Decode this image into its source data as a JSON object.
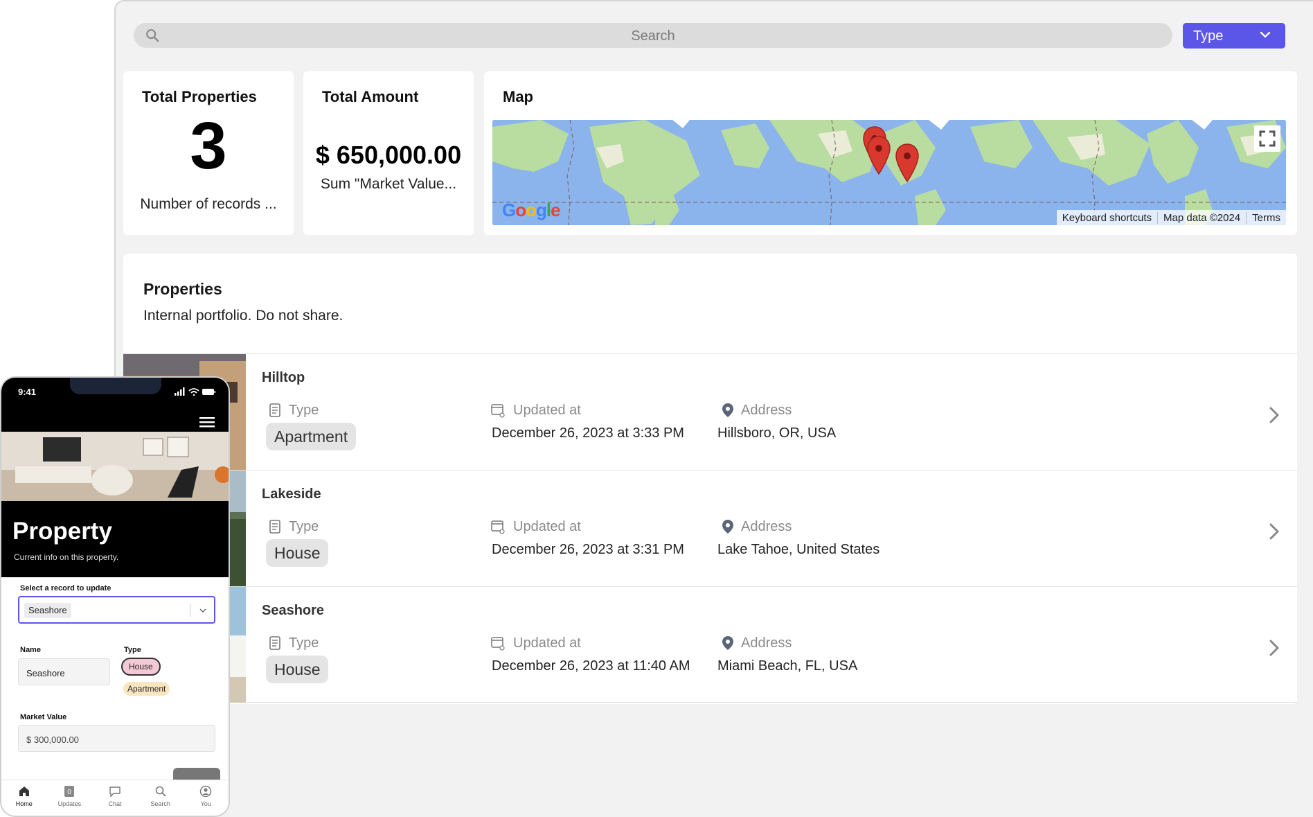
{
  "search": {
    "placeholder": "Search"
  },
  "type_filter": {
    "label": "Type"
  },
  "cards": {
    "total_properties": {
      "title": "Total Properties",
      "value": "3",
      "subtitle": "Number of records ..."
    },
    "total_amount": {
      "title": "Total Amount",
      "value": "$ 650,000.00",
      "subtitle": "Sum \"Market Value..."
    },
    "map": {
      "title": "Map",
      "logo": "Google",
      "attribution": [
        "Keyboard shortcuts",
        "Map data ©2024",
        "Terms"
      ]
    }
  },
  "properties": {
    "title": "Properties",
    "description": "Internal portfolio. Do not share.",
    "field_labels": {
      "type": "Type",
      "updated": "Updated at",
      "address": "Address"
    },
    "rows": [
      {
        "name": "Hilltop",
        "type": "Apartment",
        "updated": "December 26, 2023 at 3:33 PM",
        "address": "Hillsboro, OR, USA"
      },
      {
        "name": "Lakeside",
        "type": "House",
        "updated": "December 26, 2023 at 3:31 PM",
        "address": "Lake Tahoe, United States"
      },
      {
        "name": "Seashore",
        "type": "House",
        "updated": "December 26, 2023 at 11:40 AM",
        "address": "Miami Beach, FL, USA"
      }
    ]
  },
  "phone": {
    "time": "9:41",
    "title": "Property",
    "subtitle": "Current info on this property.",
    "select_label": "Select a record to update",
    "selected_record": "Seashore",
    "name_label": "Name",
    "name_value": "Seashore",
    "type_label": "Type",
    "type_options": [
      "House",
      "Apartment"
    ],
    "market_value_label": "Market Value",
    "market_value": "$ 300,000.00",
    "tabs": [
      {
        "label": "Home",
        "icon": "home-icon"
      },
      {
        "label": "Updates",
        "icon": "updates-icon",
        "badge": "0"
      },
      {
        "label": "Chat",
        "icon": "chat-icon"
      },
      {
        "label": "Search",
        "icon": "search-icon"
      },
      {
        "label": "You",
        "icon": "user-icon"
      }
    ]
  },
  "colors": {
    "accent": "#5b55e8",
    "map_pin": "#d9382f",
    "chip_bg": "#e4e4e4"
  }
}
